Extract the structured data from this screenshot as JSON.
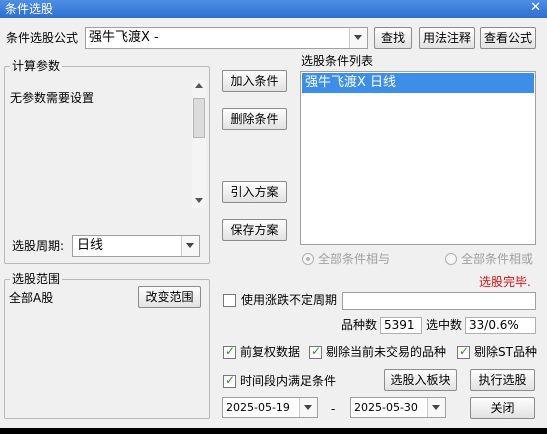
{
  "window": {
    "title": "条件选股",
    "close_icon": "✕"
  },
  "formula": {
    "label": "条件选股公式",
    "value": "强牛飞渡X    -",
    "find_button": "查找",
    "usage_button": "用法注释",
    "view_button": "查看公式"
  },
  "params": {
    "group_title": "计算参数",
    "text": "无参数需要设置",
    "period_label": "选股周期:",
    "period_value": "日线"
  },
  "buttons": {
    "add": "加入条件",
    "delete": "删除条件",
    "import": "引入方案",
    "save": "保存方案",
    "to_block": "选股入板块",
    "execute": "执行选股",
    "close": "关闭"
  },
  "conditions": {
    "title": "选股条件列表",
    "items": [
      "强牛飞渡X  日线"
    ],
    "and_label": "全部条件相与",
    "or_label": "全部条件相或"
  },
  "status": {
    "text": "选股完毕.",
    "color": "#e01010"
  },
  "range": {
    "group_title": "选股范围",
    "value": "全部A股",
    "change_button": "改变范围"
  },
  "options": {
    "variable_period": "使用涨跌不定周期",
    "variable_period_checked": false,
    "count_label": "品种数",
    "count_value": "5391",
    "selected_label": "选中数",
    "selected_value": "33/0.6%",
    "adjust": "前复权数据",
    "adjust_checked": true,
    "exclude_untraded": "剔除当前未交易的品种",
    "exclude_untraded_checked": true,
    "exclude_st": "剔除ST品种",
    "exclude_st_checked": true,
    "time_range": "时间段内满足条件",
    "time_range_checked": true
  },
  "dates": {
    "start": "2025-05-19",
    "separator": "-",
    "end": "2025-05-30"
  }
}
